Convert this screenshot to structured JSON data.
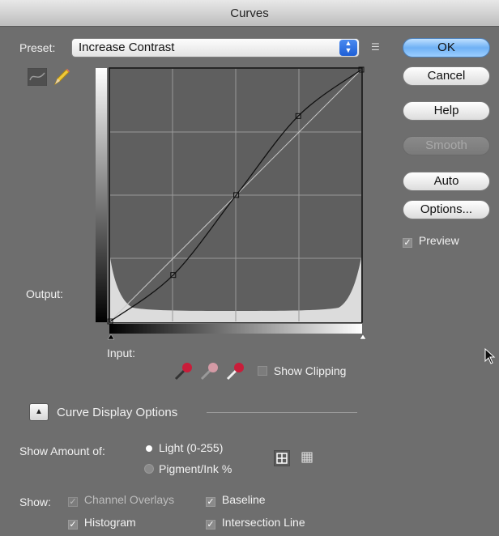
{
  "window": {
    "title": "Curves"
  },
  "preset": {
    "label": "Preset:",
    "value": "Increase Contrast"
  },
  "buttons": {
    "ok": "OK",
    "cancel": "Cancel",
    "help": "Help",
    "smooth": "Smooth",
    "auto": "Auto",
    "options": "Options..."
  },
  "preview": {
    "label": "Preview",
    "checked": true
  },
  "graph": {
    "output_label": "Output:",
    "input_label": "Input:",
    "curve_points": [
      {
        "input": 0,
        "output": 0
      },
      {
        "input": 64,
        "output": 47
      },
      {
        "input": 128,
        "output": 128
      },
      {
        "input": 191,
        "output": 208
      },
      {
        "input": 255,
        "output": 255
      }
    ],
    "show_clipping": {
      "label": "Show Clipping",
      "checked": false
    }
  },
  "curve_display_options": {
    "label": "Curve Display Options",
    "show_amount_label": "Show Amount of:",
    "light_option": "Light  (0-255)",
    "pigment_option": "Pigment/Ink %",
    "selected_amount": "light",
    "show_label": "Show:",
    "channel_overlays": {
      "label": "Channel Overlays",
      "checked": true
    },
    "baseline": {
      "label": "Baseline",
      "checked": true
    },
    "histogram": {
      "label": "Histogram",
      "checked": true
    },
    "intersection_line": {
      "label": "Intersection Line",
      "checked": true
    }
  },
  "colors": {
    "dialog_bg": "#6e6e6e",
    "graph_bg": "#5f5f5f",
    "accent_blue": "#6fb1f5"
  }
}
